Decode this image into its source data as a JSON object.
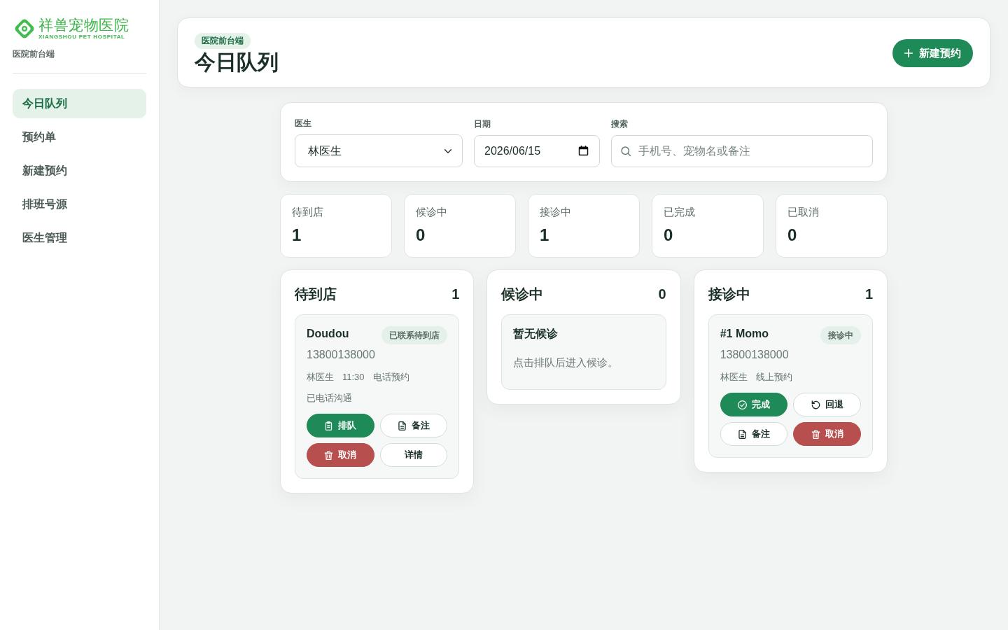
{
  "sidebar": {
    "logo": {
      "name": "祥兽宠物医院",
      "tagline": "XIANGSHOU PET HOSPITAL"
    },
    "subtitle": "医院前台端",
    "items": [
      {
        "label": "今日队列",
        "selected": true
      },
      {
        "label": "预约单",
        "selected": false
      },
      {
        "label": "新建预约",
        "selected": false
      },
      {
        "label": "排班号源",
        "selected": false
      },
      {
        "label": "医生管理",
        "selected": false
      }
    ]
  },
  "header": {
    "badge": "医院前台端",
    "title": "今日队列",
    "new_button": "新建预约"
  },
  "filters": {
    "doctor": {
      "label": "医生",
      "value": "林医生"
    },
    "date": {
      "label": "日期",
      "value": "2026/06/15"
    },
    "search": {
      "label": "搜索",
      "placeholder": "手机号、宠物名或备注"
    }
  },
  "stats": [
    {
      "label": "待到店",
      "value": "1"
    },
    {
      "label": "候诊中",
      "value": "0"
    },
    {
      "label": "接诊中",
      "value": "1"
    },
    {
      "label": "已完成",
      "value": "0"
    },
    {
      "label": "已取消",
      "value": "0"
    }
  ],
  "columns": [
    {
      "title": "待到店",
      "count": "1",
      "cards": [
        {
          "name": "Doudou",
          "badge": "已联系待到店",
          "phone": "13800138000",
          "meta": [
            "林医生",
            "11:30",
            "电话预约"
          ],
          "note": "已电话沟通",
          "actions": [
            {
              "kind": "queue",
              "label": "排队"
            },
            {
              "kind": "note",
              "label": "备注"
            },
            {
              "kind": "cancel",
              "label": "取消"
            },
            {
              "kind": "detail",
              "label": "详情"
            }
          ]
        }
      ]
    },
    {
      "title": "候诊中",
      "count": "0",
      "empty": {
        "title": "暂无候诊",
        "text": "点击排队后进入候诊。"
      }
    },
    {
      "title": "接诊中",
      "count": "1",
      "cards": [
        {
          "name": "#1 Momo",
          "badge": "接诊中",
          "phone": "13800138000",
          "meta": [
            "林医生",
            "线上预约"
          ],
          "actions": [
            {
              "kind": "complete",
              "label": "完成"
            },
            {
              "kind": "revert",
              "label": "回退"
            },
            {
              "kind": "note",
              "label": "备注"
            },
            {
              "kind": "cancel",
              "label": "取消"
            }
          ]
        }
      ]
    }
  ]
}
